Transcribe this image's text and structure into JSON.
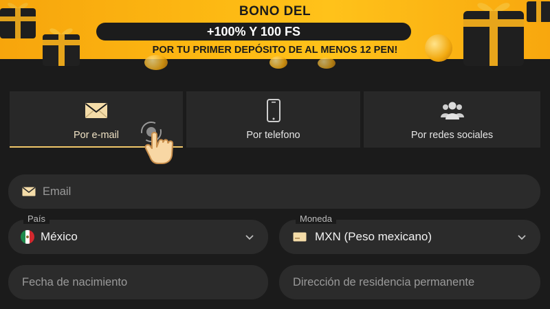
{
  "banner": {
    "title": "BONO DEL",
    "highlight": "+100% Y 100 FS",
    "subtitle": "POR TU PRIMER DEPÓSITO DE AL MENOS 12 PEN!"
  },
  "tabs": [
    {
      "label": "Por e-mail",
      "icon": "envelope-icon",
      "active": true
    },
    {
      "label": "Por telefono",
      "icon": "phone-icon",
      "active": false
    },
    {
      "label": "Por redes sociales",
      "icon": "users-icon",
      "active": false
    }
  ],
  "form": {
    "email": {
      "placeholder": "Email"
    },
    "country": {
      "label": "País",
      "value": "México"
    },
    "currency": {
      "label": "Moneda",
      "value": "MXN (Peso mexicano)"
    },
    "birthdate": {
      "placeholder": "Fecha de nacimiento"
    },
    "residence": {
      "placeholder": "Dirección de residencia permanente"
    }
  },
  "colors": {
    "accent": "#f2c86a",
    "banner": "#fdb913",
    "background": "#1b1b1b",
    "field": "#2b2b2b"
  }
}
